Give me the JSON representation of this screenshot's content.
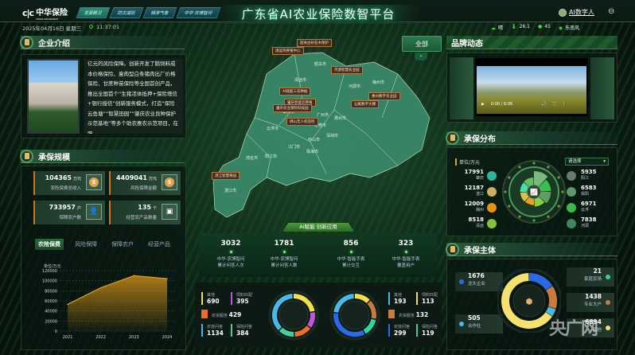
{
  "header": {
    "logo": "中华保险",
    "logo_sub": "CHINA INSURANCE",
    "nav": [
      "发展概况",
      "防灾减损",
      "精准气象",
      "中华·农博智问"
    ],
    "title": "广东省AI农业保险数智平台",
    "date": "2025年04月16日 星期三",
    "time": "11:37:01",
    "user": "AI数字人",
    "weather": {
      "condition": "晴",
      "temperature": "26.1",
      "humidity": "45",
      "wind": "东南风"
    }
  },
  "intro": {
    "title": "企业介绍",
    "text": "亿元的风险保障。创新开发了鹅饲料成本价格保险、廋肉型白条猪肉出厂价格保险、甘蔗种苗保险等全国首创产品，推出全国首个“生猪活体抵押+保险增信+银行授信”创新服务模式，打造“保险云鱼塘”“智慧田园”“肇庆农业良种保护示范基地”等多个助农惠农示范项目，在服"
  },
  "scale": {
    "title": "承保规模",
    "stats": [
      {
        "value": "104365",
        "unit": "万元",
        "label": "农险保费总收入",
        "icon": "dollar-icon"
      },
      {
        "value": "4409041",
        "unit": "万元",
        "label": "风险保障金额",
        "icon": "dollar-icon"
      },
      {
        "value": "733957",
        "unit": "户",
        "label": "保障农户数",
        "icon": "user-icon"
      },
      {
        "value": "135",
        "unit": "个",
        "label": "经营农产品数量",
        "icon": "box-icon"
      }
    ],
    "tabs": [
      "农险保费",
      "风险保障",
      "保障农户",
      "经营产品"
    ]
  },
  "chart_data": {
    "type": "area",
    "title": "",
    "ylabel": "单位/万元",
    "xlabel": "",
    "categories": [
      "2021",
      "2022",
      "2023",
      "2024"
    ],
    "values": [
      53000,
      86000,
      110000,
      104000
    ],
    "ylim": [
      0,
      120000
    ],
    "yticks": [
      "0",
      "20000",
      "40000",
      "60000",
      "80000",
      "100000",
      "120000"
    ],
    "color": "#e0a020"
  },
  "map": {
    "filter": "全部",
    "cities": [
      "韶关市",
      "清远市",
      "河源市",
      "梅州市",
      "广州市",
      "惠州市",
      "东莞市",
      "云浮市",
      "肇庆市",
      "江门市",
      "中山市",
      "深圳市",
      "珠海市",
      "阳江市",
      "茂名市",
      "湛江市"
    ],
    "labels": [
      "韶关古树名木保护",
      "清远鸡养殖中心",
      "河源智慧农业园",
      "AI赋能三农种植",
      "肇庆智能云养殖",
      "肇庆农业保险科技园",
      "佛山无人机巡检",
      "汕尾数字大棚",
      "惠州数字农业园",
      "湛江智慧果园"
    ]
  },
  "ai": {
    "banner": "AI赋能 创新应用",
    "stats": [
      {
        "value": "3032",
        "label1": "中华·农博智问",
        "label2": "累计问答人次"
      },
      {
        "value": "1781",
        "label1": "中华·农博智问",
        "label2": "累计问答人数"
      },
      {
        "value": "856",
        "label1": "中华·智能手表",
        "label2": "累计交互"
      },
      {
        "value": "323",
        "label1": "中华·智能手表",
        "label2": "覆盖用户"
      }
    ],
    "donut_left": [
      {
        "label": "其他",
        "value": 690,
        "color": "#f5e04a"
      },
      {
        "label": "饲料匹配",
        "value": 395,
        "color": "#c056e0"
      },
      {
        "label": "农资服务",
        "value": 429,
        "color": "#f06a2a"
      },
      {
        "label": "保险问答",
        "value": 384,
        "color": "#40d0a0"
      },
      {
        "label": "农技问答",
        "value": 1134,
        "color": "#4ab8e8"
      }
    ],
    "donut_right": [
      {
        "label": "饲料匹配",
        "value": 113,
        "color": "#f5e04a"
      },
      {
        "label": "农资服务",
        "value": 132,
        "color": "#c87a40"
      },
      {
        "label": "保险问答",
        "value": 119,
        "color": "#2ad8a0"
      },
      {
        "label": "农技问答",
        "value": 299,
        "color": "#2a6ae8"
      },
      {
        "label": "其他",
        "value": 193,
        "color": "#4ab8e8"
      }
    ]
  },
  "brand": {
    "title": "品牌动态",
    "video_time": "0:00 / 6:06"
  },
  "distribution": {
    "title": "承保分布",
    "unit": "单位/万元",
    "select": "请选择",
    "left": [
      {
        "value": "17991",
        "city": "肇庆",
        "color": "#2ab89a"
      },
      {
        "value": "12187",
        "city": "湛江",
        "color": "#c8b060"
      },
      {
        "value": "12009",
        "city": "梅州",
        "color": "#e8901a"
      },
      {
        "value": "8518",
        "city": "清远",
        "color": "#8ac040"
      }
    ],
    "right": [
      {
        "value": "5935",
        "city": "阳江",
        "color": "#6a7a6a"
      },
      {
        "value": "6583",
        "city": "揭阳",
        "color": "#5a9a6a"
      },
      {
        "value": "6971",
        "city": "云浮",
        "color": "#3ab84a"
      },
      {
        "value": "7838",
        "city": "河源",
        "color": "#3a8a5a"
      }
    ]
  },
  "entities": {
    "title": "承保主体",
    "items": [
      {
        "label": "龙头企业",
        "value": 1676,
        "color": "#2a6ae8"
      },
      {
        "label": "家庭农场",
        "value": 21,
        "color": "#2ad8a0"
      },
      {
        "label": "专业大户",
        "value": 1438,
        "color": "#c87a40"
      },
      {
        "label": "合作社",
        "value": 505,
        "color": "#4ab8e8"
      },
      {
        "label": "其他",
        "value": 6894,
        "color": "#f5e070"
      }
    ]
  },
  "watermark": "央广网"
}
